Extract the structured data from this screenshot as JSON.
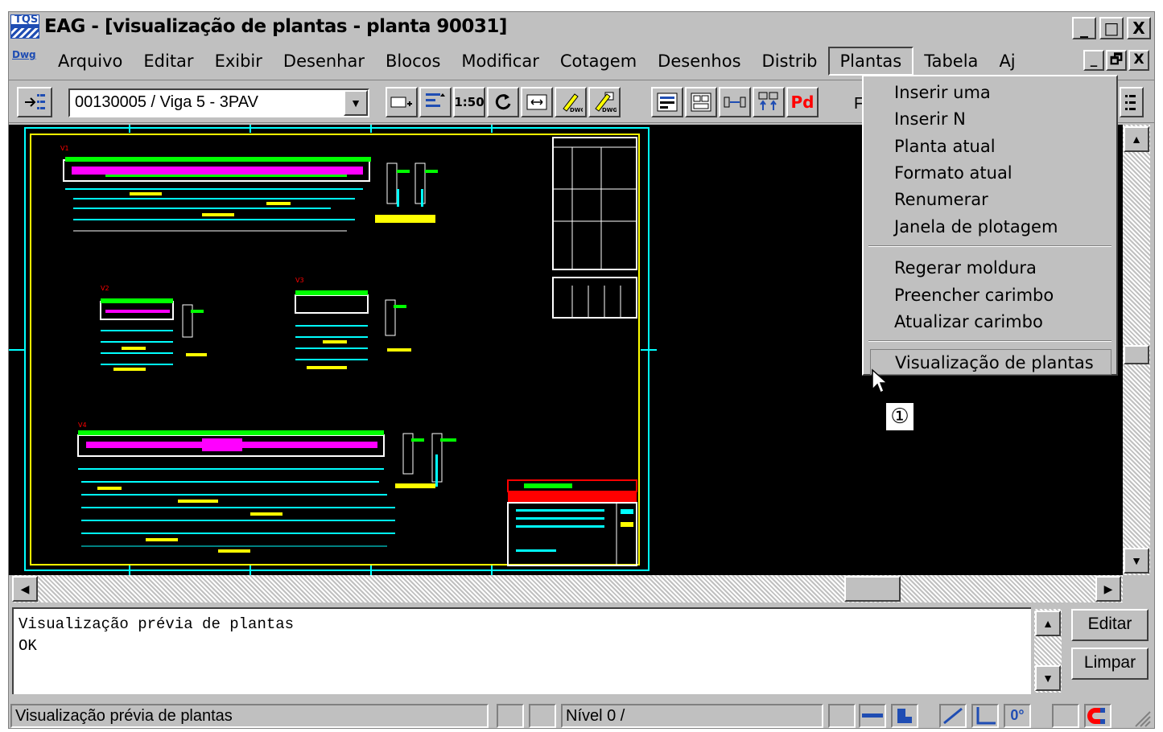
{
  "window": {
    "title": "EAG - [visualização de plantas - planta 90031]",
    "app_icon_text": "TQS",
    "controls": [
      "_",
      "□",
      "X"
    ]
  },
  "menubar": {
    "doc_icon_text": "Dwg",
    "items": [
      "Arquivo",
      "Editar",
      "Exibir",
      "Desenhar",
      "Blocos",
      "Modificar",
      "Cotagem",
      "Desenhos",
      "Distrib",
      "Plantas",
      "Tabela",
      "Aj"
    ],
    "active": "Plantas",
    "mdi_controls": [
      "_",
      "🗗",
      "X"
    ]
  },
  "toolbar": {
    "combo_value": "00130005 / Viga 5 - 3PAV",
    "scale_label": "1:50",
    "pd_label": "Pd",
    "trailing_label": "F"
  },
  "plantas_menu": {
    "items": [
      "Inserir uma",
      "Inserir N",
      "Planta atual",
      "Formato atual",
      "Renumerar",
      "Janela de plotagem",
      "Regerar moldura",
      "Preencher carimbo",
      "Atualizar carimbo",
      "Visualização de plantas"
    ],
    "highlighted": "Visualização de plantas"
  },
  "callout": {
    "number": "①"
  },
  "command": {
    "lines": [
      "Visualização prévia de plantas",
      "OK"
    ],
    "edit_button": "Editar",
    "clear_button": "Limpar"
  },
  "statusbar": {
    "message": "Visualização prévia de plantas",
    "level": "Nível 0 /",
    "angle_label": "0°"
  },
  "colors": {
    "canvas_bg": "#000000",
    "border_yellow": "#ffff00",
    "cyan": "#00ffff",
    "magenta": "#ff00ff",
    "green": "#00ff00",
    "red": "#ff0000",
    "dialog_gray": "#c0c0c0"
  }
}
